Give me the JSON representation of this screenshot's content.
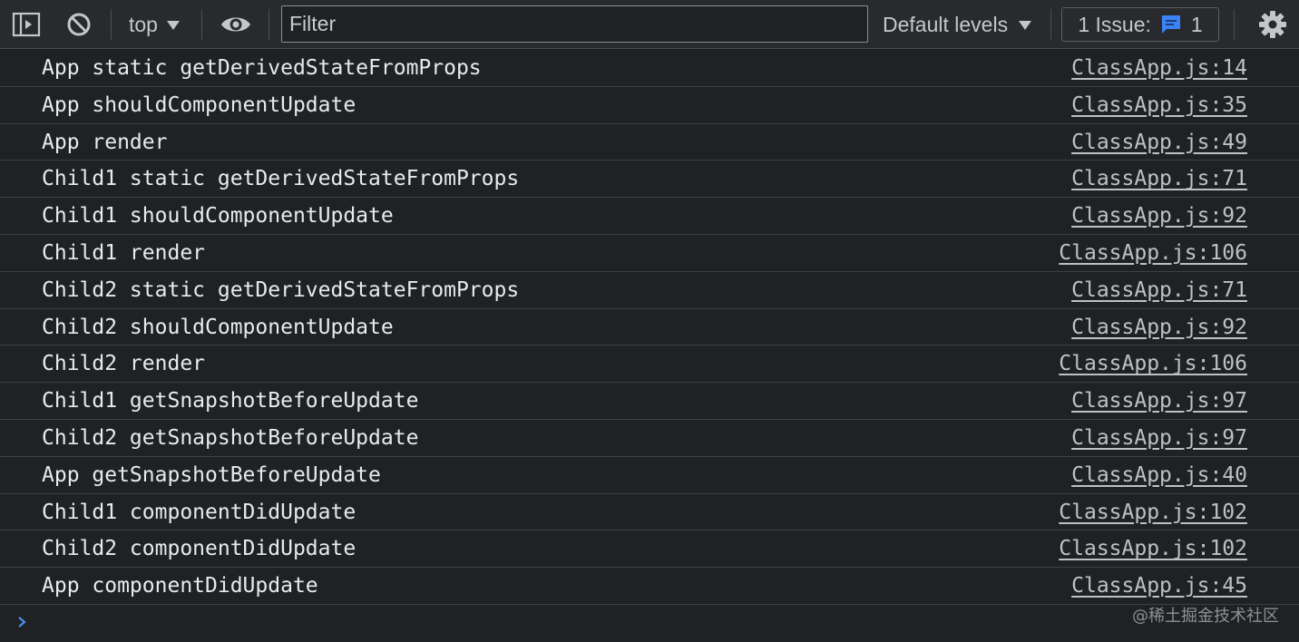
{
  "toolbar": {
    "context": "top",
    "filter_placeholder": "Filter",
    "levels": "Default levels",
    "issues_label": "1 Issue:",
    "issues_count": "1"
  },
  "rows": [
    {
      "message": "App static getDerivedStateFromProps",
      "source": "ClassApp.js:14"
    },
    {
      "message": "App shouldComponentUpdate",
      "source": "ClassApp.js:35"
    },
    {
      "message": "App render",
      "source": "ClassApp.js:49"
    },
    {
      "message": "Child1 static getDerivedStateFromProps",
      "source": "ClassApp.js:71"
    },
    {
      "message": "Child1 shouldComponentUpdate",
      "source": "ClassApp.js:92"
    },
    {
      "message": "Child1 render",
      "source": "ClassApp.js:106"
    },
    {
      "message": "Child2 static getDerivedStateFromProps",
      "source": "ClassApp.js:71"
    },
    {
      "message": "Child2 shouldComponentUpdate",
      "source": "ClassApp.js:92"
    },
    {
      "message": "Child2 render",
      "source": "ClassApp.js:106"
    },
    {
      "message": "Child1 getSnapshotBeforeUpdate",
      "source": "ClassApp.js:97"
    },
    {
      "message": "Child2 getSnapshotBeforeUpdate",
      "source": "ClassApp.js:97"
    },
    {
      "message": "App getSnapshotBeforeUpdate",
      "source": "ClassApp.js:40"
    },
    {
      "message": "Child1 componentDidUpdate",
      "source": "ClassApp.js:102"
    },
    {
      "message": "Child2 componentDidUpdate",
      "source": "ClassApp.js:102"
    },
    {
      "message": "App componentDidUpdate",
      "source": "ClassApp.js:45"
    }
  ],
  "watermark": "@稀土掘金技术社区",
  "icons": {
    "sidebar": "sidebar-toggle-icon",
    "clear": "clear-console-icon",
    "eye": "live-expression-eye-icon",
    "issue": "issue-message-icon",
    "settings": "gear-icon",
    "prompt": "chevron-right-icon"
  },
  "colors": {
    "background": "#202124",
    "toolbar": "#292a2d",
    "issue_icon": "#3b82f6",
    "prompt": "#4a8cf0"
  }
}
